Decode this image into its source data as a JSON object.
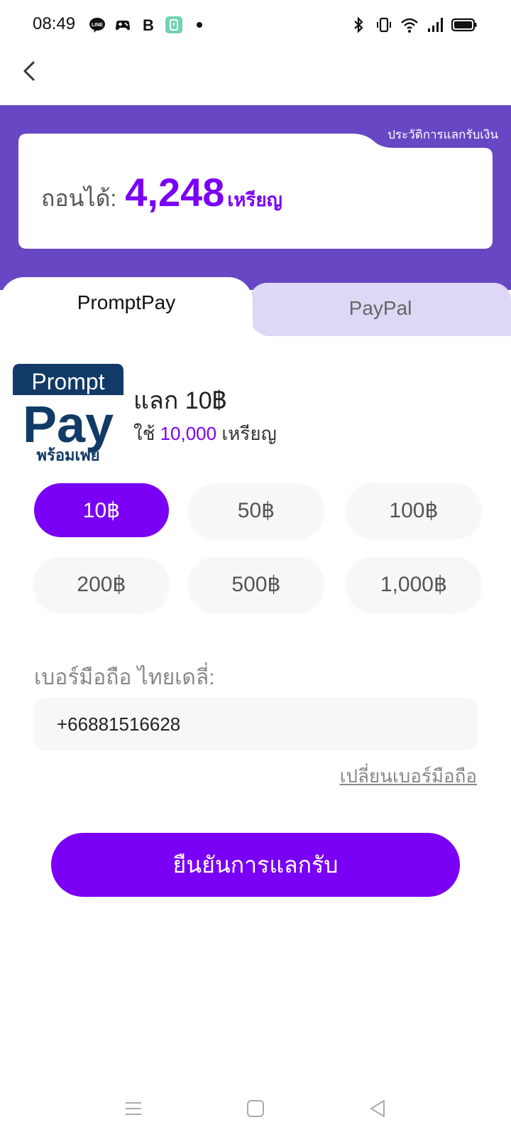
{
  "status_bar": {
    "time": "08:49",
    "left_icons": [
      "line-icon",
      "game-controller-icon",
      "b-app-icon",
      "clock-app-icon",
      "dot-icon"
    ],
    "right_icons": [
      "bluetooth-icon",
      "vibrate-icon",
      "wifi-icon",
      "signal-icon",
      "battery-icon"
    ]
  },
  "header": {
    "back_icon": "chevron-left-icon"
  },
  "banner": {
    "history_link": "ประวัติการแลกรับเงิน",
    "balance_label": "ถอนได้:",
    "balance_value": "4,248",
    "balance_unit": "เหรียญ"
  },
  "tabs": [
    {
      "label": "PromptPay",
      "active": true
    },
    {
      "label": "PayPal",
      "active": false
    }
  ],
  "promptpay": {
    "logo_top": "Prompt",
    "logo_main": "Pay",
    "logo_thai": "พร้อมเพย์",
    "title": "แลก 10฿",
    "sub_prefix": "ใช้",
    "sub_coins": "10,000",
    "sub_unit": "เหรียญ"
  },
  "amounts": [
    {
      "label": "10฿",
      "selected": true
    },
    {
      "label": "50฿",
      "selected": false
    },
    {
      "label": "100฿",
      "selected": false
    },
    {
      "label": "200฿",
      "selected": false
    },
    {
      "label": "500฿",
      "selected": false
    },
    {
      "label": "1,000฿",
      "selected": false
    }
  ],
  "phone": {
    "label": "เบอร์มือถือ ไทยเดลี่:",
    "value": "+66881516628",
    "change_link": "เปลี่ยนเบอร์มือถือ"
  },
  "confirm_button": "ยืนยันการแลกรับ",
  "nav_bar": [
    "menu-icon",
    "home-square-icon",
    "back-triangle-icon"
  ],
  "colors": {
    "accent": "#7a00f5",
    "banner": "#6747c4",
    "tab_inactive": "#ded7f5"
  }
}
